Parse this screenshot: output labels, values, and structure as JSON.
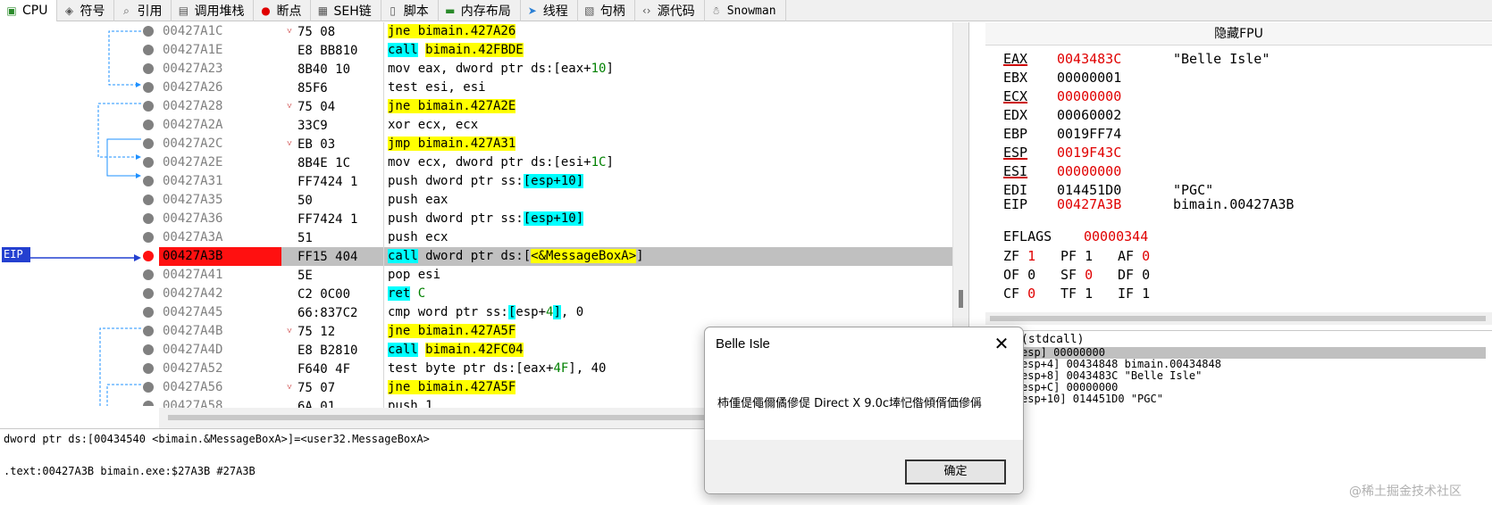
{
  "tabs": [
    {
      "label": "CPU",
      "icon": "cpu-icon",
      "active": true
    },
    {
      "label": "符号",
      "icon": "symbols-icon"
    },
    {
      "label": "引用",
      "icon": "search-icon"
    },
    {
      "label": "调用堆栈",
      "icon": "callstack-icon"
    },
    {
      "label": "断点",
      "icon": "breakpoint-icon"
    },
    {
      "label": "SEH链",
      "icon": "seh-icon"
    },
    {
      "label": "脚本",
      "icon": "script-icon"
    },
    {
      "label": "内存布局",
      "icon": "memory-icon"
    },
    {
      "label": "线程",
      "icon": "thread-icon"
    },
    {
      "label": "句柄",
      "icon": "handle-icon"
    },
    {
      "label": "源代码",
      "icon": "code-icon"
    },
    {
      "label": "Snowman",
      "icon": "snowman-icon"
    }
  ],
  "disasm": {
    "eip_label": "EIP",
    "rows": [
      {
        "addr": "00427A1C",
        "mark": "˅",
        "bytes": "75 08",
        "parts": [
          {
            "t": "jne bimain.427A26",
            "c": "y"
          }
        ]
      },
      {
        "addr": "00427A1E",
        "mark": "",
        "bytes": "E8 BB810",
        "parts": [
          {
            "t": "call",
            "c": "c"
          },
          {
            "t": " "
          },
          {
            "t": "bimain.42FBDE",
            "c": "y"
          }
        ]
      },
      {
        "addr": "00427A23",
        "mark": "",
        "bytes": "8B40 10",
        "parts": [
          {
            "t": "mov eax, dword ptr ds:[eax+"
          },
          {
            "t": "10",
            "c": "n"
          },
          {
            "t": "]"
          }
        ]
      },
      {
        "addr": "00427A26",
        "mark": "",
        "bytes": "85F6",
        "parts": [
          {
            "t": "test esi, esi"
          }
        ]
      },
      {
        "addr": "00427A28",
        "mark": "˅",
        "bytes": "75 04",
        "parts": [
          {
            "t": "jne bimain.427A2E",
            "c": "y"
          }
        ]
      },
      {
        "addr": "00427A2A",
        "mark": "",
        "bytes": "33C9",
        "parts": [
          {
            "t": "xor ecx, ecx"
          }
        ]
      },
      {
        "addr": "00427A2C",
        "mark": "˅",
        "bytes": "EB 03",
        "parts": [
          {
            "t": "jmp bimain.427A31",
            "c": "y"
          }
        ]
      },
      {
        "addr": "00427A2E",
        "mark": "",
        "bytes": "8B4E 1C",
        "parts": [
          {
            "t": "mov ecx, dword ptr ds:[esi+"
          },
          {
            "t": "1C",
            "c": "n"
          },
          {
            "t": "]"
          }
        ]
      },
      {
        "addr": "00427A31",
        "mark": "",
        "bytes": "FF7424 1",
        "parts": [
          {
            "t": "push dword ptr ss:"
          },
          {
            "t": "[esp+10]",
            "c": "c"
          }
        ]
      },
      {
        "addr": "00427A35",
        "mark": "",
        "bytes": "50",
        "parts": [
          {
            "t": "push eax"
          }
        ]
      },
      {
        "addr": "00427A36",
        "mark": "",
        "bytes": "FF7424 1",
        "parts": [
          {
            "t": "push dword ptr ss:"
          },
          {
            "t": "[esp+10]",
            "c": "c"
          }
        ]
      },
      {
        "addr": "00427A3A",
        "mark": "",
        "bytes": "51",
        "parts": [
          {
            "t": "push ecx"
          }
        ]
      },
      {
        "addr": "00427A3B",
        "mark": "",
        "bytes": "FF15 404",
        "eip": true,
        "parts": [
          {
            "t": "call",
            "c": "c"
          },
          {
            "t": " dword ptr ds:["
          },
          {
            "t": "<&MessageBoxA>",
            "c": "y"
          },
          {
            "t": "]"
          }
        ]
      },
      {
        "addr": "00427A41",
        "mark": "",
        "bytes": "5E",
        "parts": [
          {
            "t": "pop esi"
          }
        ]
      },
      {
        "addr": "00427A42",
        "mark": "",
        "bytes": "C2 0C00",
        "parts": [
          {
            "t": "ret",
            "c": "c"
          },
          {
            "t": " "
          },
          {
            "t": "C",
            "c": "n"
          }
        ]
      },
      {
        "addr": "00427A45",
        "mark": "",
        "bytes": "66:837C2",
        "parts": [
          {
            "t": "cmp word ptr ss:"
          },
          {
            "t": "[",
            "c": "c"
          },
          {
            "t": "esp+"
          },
          {
            "t": "4",
            "c": "n"
          },
          {
            "t": "]",
            "c": "c"
          },
          {
            "t": ", 0"
          }
        ]
      },
      {
        "addr": "00427A4B",
        "mark": "˅",
        "bytes": "75 12",
        "parts": [
          {
            "t": "jne bimain.427A5F",
            "c": "y"
          }
        ]
      },
      {
        "addr": "00427A4D",
        "mark": "",
        "bytes": "E8 B2810",
        "parts": [
          {
            "t": "call",
            "c": "c"
          },
          {
            "t": " "
          },
          {
            "t": "bimain.42FC04",
            "c": "y"
          }
        ]
      },
      {
        "addr": "00427A52",
        "mark": "",
        "bytes": "F640 4F",
        "parts": [
          {
            "t": "test byte ptr ds:[eax+"
          },
          {
            "t": "4F",
            "c": "n"
          },
          {
            "t": "], 40"
          }
        ]
      },
      {
        "addr": "00427A56",
        "mark": "˅",
        "bytes": "75 07",
        "parts": [
          {
            "t": "jne bimain.427A5F",
            "c": "y"
          }
        ]
      },
      {
        "addr": "00427A58",
        "mark": "",
        "bytes": "6A 01",
        "parts": [
          {
            "t": "push 1"
          }
        ]
      }
    ]
  },
  "info": {
    "line1": "dword ptr ds:[00434540 <bimain.&MessageBoxA>]=<user32.MessageBoxA>",
    "line2": ".text:00427A3B bimain.exe:$27A3B #27A3B"
  },
  "registers": {
    "hide_fpu": "隐藏FPU",
    "list": [
      {
        "name": "EAX",
        "value": "0043483C",
        "comment": "\"Belle Isle\"",
        "changed": true
      },
      {
        "name": "EBX",
        "value": "00000001",
        "comment": "",
        "changed": false
      },
      {
        "name": "ECX",
        "value": "00000000",
        "comment": "",
        "changed": true
      },
      {
        "name": "EDX",
        "value": "00060002",
        "comment": "",
        "changed": false
      },
      {
        "name": "EBP",
        "value": "0019FF74",
        "comment": "",
        "changed": false
      },
      {
        "name": "ESP",
        "value": "0019F43C",
        "comment": "",
        "changed": true
      },
      {
        "name": "ESI",
        "value": "00000000",
        "comment": "",
        "changed": true
      },
      {
        "name": "EDI",
        "value": "014451D0",
        "comment": "\"PGC\"",
        "changed": false
      }
    ],
    "eip": {
      "name": "EIP",
      "value": "00427A3B",
      "comment": "bimain.00427A3B"
    },
    "eflags": {
      "name": "EFLAGS",
      "value": "00000344"
    },
    "flags": [
      [
        {
          "n": "ZF",
          "v": "1",
          "r": true
        },
        {
          "n": "PF",
          "v": "1",
          "r": false
        },
        {
          "n": "AF",
          "v": "0",
          "r": true
        }
      ],
      [
        {
          "n": "OF",
          "v": "0",
          "r": false
        },
        {
          "n": "SF",
          "v": "0",
          "r": true
        },
        {
          "n": "DF",
          "v": "0",
          "r": false
        }
      ],
      [
        {
          "n": "CF",
          "v": "0",
          "r": true
        },
        {
          "n": "TF",
          "v": "1",
          "r": false
        },
        {
          "n": "IF",
          "v": "1",
          "r": false
        }
      ]
    ]
  },
  "stack": {
    "header": "(stdcall)",
    "rows": [
      "esp] 00000000",
      "esp+4] 00434848 bimain.00434848",
      "esp+8] 0043483C \"Belle Isle\"",
      "esp+C] 00000000",
      "esp+10] 014451D0 \"PGC\""
    ]
  },
  "dialog": {
    "title": "Belle Isle",
    "message": "柿偅偍僶儞僪傪偍 Direct X 9.0c埲忋偺傾偦価傪偁",
    "ok_label": "确定"
  },
  "watermark": "@稀土掘金技术社区"
}
